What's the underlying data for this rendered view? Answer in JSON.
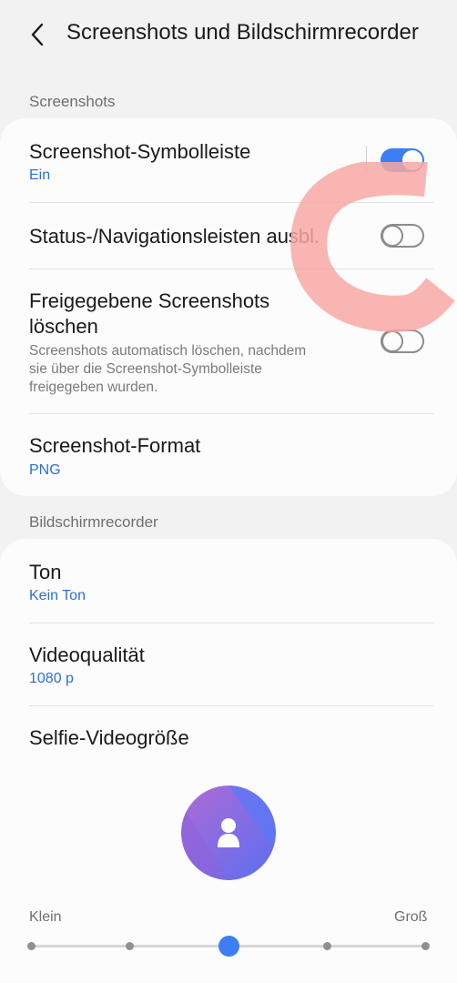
{
  "header": {
    "title": "Screenshots und Bildschirmrecorder",
    "back_icon": "chevron-left-icon"
  },
  "sections": {
    "screenshots": "Screenshots",
    "recorder": "Bildschirmrecorder"
  },
  "screenshots": {
    "toolbar": {
      "title": "Screenshot-Symbolleiste",
      "value": "Ein",
      "enabled": true
    },
    "hide_bars": {
      "title": "Status-/Navigationsleisten ausbl.",
      "enabled": false
    },
    "delete_shared": {
      "title_line1": "Freigegebene Screenshots",
      "title_line2": "löschen",
      "desc_line1": "Screenshots automatisch löschen, nachdem",
      "desc_line2": "sie über die Screenshot-Symbolleiste",
      "desc_line3": "freigegeben wurden.",
      "enabled": false
    },
    "format": {
      "title": "Screenshot-Format",
      "value": "PNG"
    }
  },
  "recorder": {
    "sound": {
      "title": "Ton",
      "value": "Kein Ton"
    },
    "quality": {
      "title": "Videoqualität",
      "value": "1080 p"
    },
    "selfie_size": {
      "title": "Selfie-Videogröße",
      "min_label": "Klein",
      "max_label": "Groß",
      "steps": 5,
      "selected_step": 3
    }
  },
  "colors": {
    "accent": "#3b7ff2",
    "link": "#2e6fd6",
    "gesture_overlay": "#f7a8a4"
  }
}
